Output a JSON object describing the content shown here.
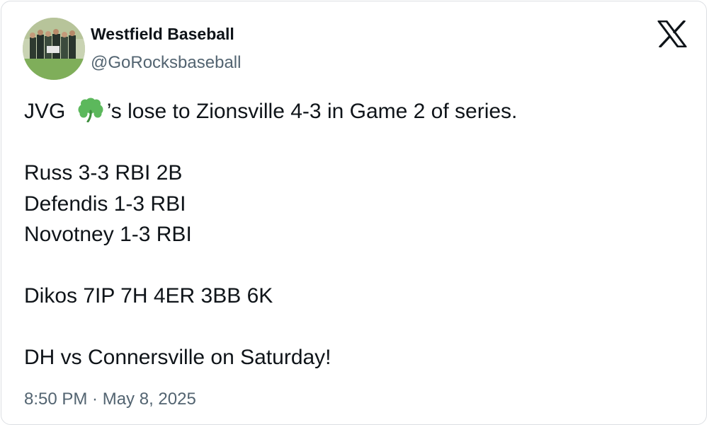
{
  "tweet": {
    "author": {
      "display_name": "Westfield Baseball",
      "handle": "@GoRocksbaseball",
      "avatar_icon": "team-photo-avatar"
    },
    "platform_icon": "x-logo-icon",
    "text_lines": [
      {
        "before": "JVG ",
        "emoji": "shamrock-emoji",
        "after": "’s lose to Zionsville 4-3 in Game 2 of series."
      },
      {
        "text": ""
      },
      {
        "text": "Russ 3-3 RBI 2B"
      },
      {
        "text": "Defendis 1-3 RBI"
      },
      {
        "text": "Novotney 1-3 RBI"
      },
      {
        "text": ""
      },
      {
        "text": "Dikos 7IP 7H 4ER 3BB 6K"
      },
      {
        "text": ""
      },
      {
        "text": "DH vs Connersville on Saturday!"
      }
    ],
    "timestamp": "8:50 PM · May 8, 2025"
  },
  "colors": {
    "text_primary": "#0f1419",
    "text_secondary": "#536471",
    "border": "#dcdfe3",
    "shamrock_green": "#4caf50"
  }
}
